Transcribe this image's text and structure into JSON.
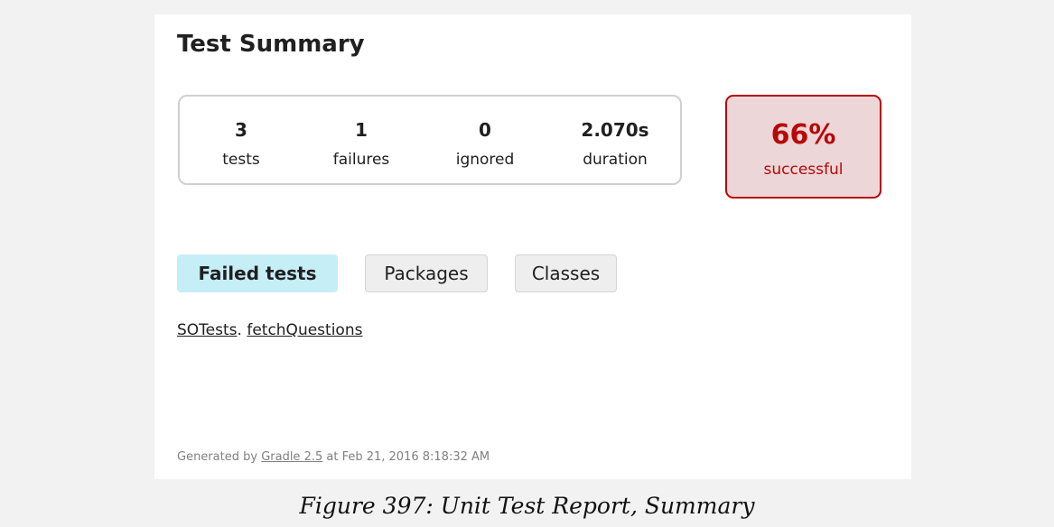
{
  "page_title": "Test Summary",
  "summary": {
    "tests": {
      "value": "3",
      "label": "tests"
    },
    "failures": {
      "value": "1",
      "label": "failures"
    },
    "ignored": {
      "value": "0",
      "label": "ignored"
    },
    "duration": {
      "value": "2.070s",
      "label": "duration"
    }
  },
  "success": {
    "percent": "66%",
    "label": "successful",
    "color": "#b60808",
    "background": "#ecd6d8"
  },
  "tabs": [
    {
      "label": "Failed tests",
      "selected": true
    },
    {
      "label": "Packages",
      "selected": false
    },
    {
      "label": "Classes",
      "selected": false
    }
  ],
  "failed_tests": {
    "class_name": "SOTests",
    "separator": ". ",
    "method_name": "fetchQuestions"
  },
  "footer": {
    "prefix": "Generated by ",
    "link": "Gradle 2.5",
    "suffix": " at Feb 21, 2016 8:18:32 AM"
  },
  "caption": "Figure 397: Unit Test Report, Summary"
}
